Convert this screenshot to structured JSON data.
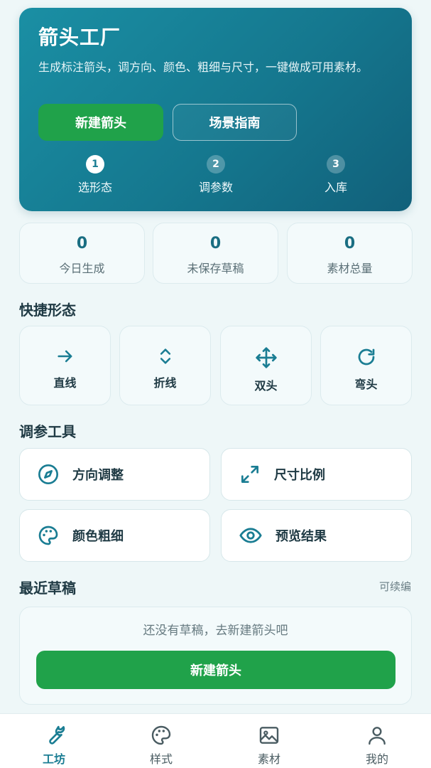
{
  "hero": {
    "title": "箭头工厂",
    "description": "生成标注箭头，调方向、颜色、粗细与尺寸，一键做成可用素材。",
    "primary_button": "新建箭头",
    "secondary_button": "场景指南",
    "steps": [
      {
        "num": "1",
        "label": "选形态",
        "active": true
      },
      {
        "num": "2",
        "label": "调参数",
        "active": false
      },
      {
        "num": "3",
        "label": "入库",
        "active": false
      }
    ]
  },
  "stats": [
    {
      "value": "0",
      "label": "今日生成"
    },
    {
      "value": "0",
      "label": "未保存草稿"
    },
    {
      "value": "0",
      "label": "素材总量"
    }
  ],
  "quick": {
    "title": "快捷形态",
    "items": [
      {
        "label": "直线",
        "icon": "arrow-right-icon"
      },
      {
        "label": "折线",
        "icon": "chevron-up-down-icon"
      },
      {
        "label": "双头",
        "icon": "move-cross-icon"
      },
      {
        "label": "弯头",
        "icon": "rotate-cw-icon"
      }
    ]
  },
  "tools": {
    "title": "调参工具",
    "items": [
      {
        "label": "方向调整",
        "icon": "compass-icon"
      },
      {
        "label": "尺寸比例",
        "icon": "expand-arrows-icon"
      },
      {
        "label": "颜色粗细",
        "icon": "palette-icon"
      },
      {
        "label": "预览结果",
        "icon": "eye-icon"
      }
    ]
  },
  "recent": {
    "title": "最近草稿",
    "link": "可续编",
    "empty_text": "还没有草稿，去新建箭头吧",
    "button": "新建箭头"
  },
  "tabbar": {
    "items": [
      {
        "label": "工坊",
        "icon": "wrench-icon",
        "active": true
      },
      {
        "label": "样式",
        "icon": "palette-icon",
        "active": false
      },
      {
        "label": "素材",
        "icon": "image-icon",
        "active": false
      },
      {
        "label": "我的",
        "icon": "user-icon",
        "active": false
      }
    ]
  },
  "colors": {
    "accent": "#1a7d93",
    "primary_green": "#20a24a",
    "background": "#eef7f8"
  }
}
